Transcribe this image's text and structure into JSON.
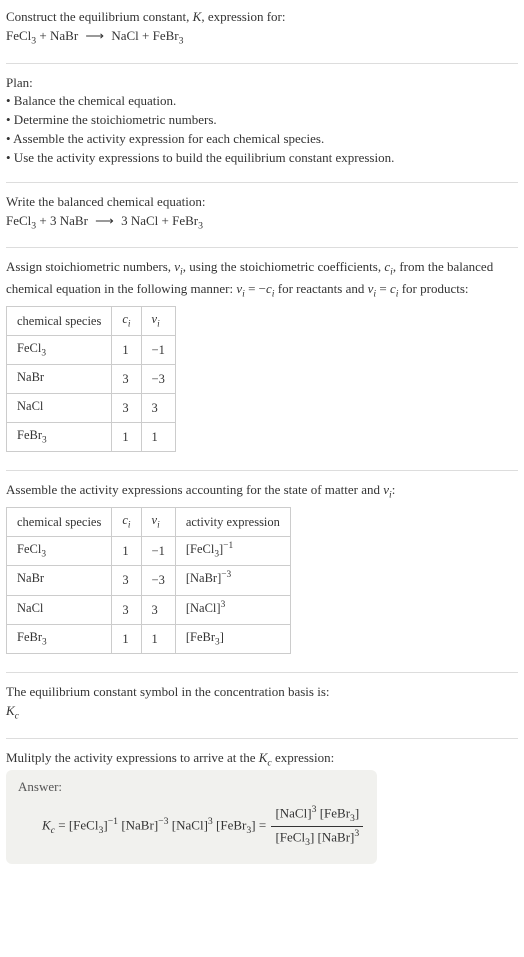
{
  "intro": {
    "line1_a": "Construct the equilibrium constant, ",
    "line1_k": "K",
    "line1_b": ", expression for:",
    "eq_lhs_a": "FeCl",
    "eq_lhs_b": " + NaBr",
    "eq_arrow": "⟶",
    "eq_rhs_a": "NaCl + FeBr"
  },
  "plan": {
    "heading": "Plan:",
    "b1": "• Balance the chemical equation.",
    "b2": "• Determine the stoichiometric numbers.",
    "b3": "• Assemble the activity expression for each chemical species.",
    "b4": "• Use the activity expressions to build the equilibrium constant expression."
  },
  "balanced": {
    "heading": "Write the balanced chemical equation:",
    "lhs_a": "FeCl",
    "lhs_b": " + 3 NaBr",
    "arrow": "⟶",
    "rhs_a": "3 NaCl + FeBr"
  },
  "assign": {
    "text_a": "Assign stoichiometric numbers, ",
    "nu": "ν",
    "sub_i": "i",
    "text_b": ", using the stoichiometric coefficients, ",
    "c": "c",
    "text_c": ", from the balanced chemical equation in the following manner: ",
    "rel1_a": "ν",
    "rel1_b": " = −",
    "rel1_c": "c",
    "text_d": " for reactants and ",
    "rel2_a": "ν",
    "rel2_b": " = ",
    "rel2_c": "c",
    "text_e": " for products:"
  },
  "table1": {
    "h1": "chemical species",
    "h2": "c",
    "h3": "ν",
    "hsub": "i",
    "rows": [
      {
        "s": "FeCl",
        "sub": "3",
        "c": "1",
        "v": "−1"
      },
      {
        "s": "NaBr",
        "sub": "",
        "c": "3",
        "v": "−3"
      },
      {
        "s": "NaCl",
        "sub": "",
        "c": "3",
        "v": "3"
      },
      {
        "s": "FeBr",
        "sub": "3",
        "c": "1",
        "v": "1"
      }
    ]
  },
  "assemble": {
    "text_a": "Assemble the activity expressions accounting for the state of matter and ",
    "nu": "ν",
    "sub_i": "i",
    "text_b": ":"
  },
  "table2": {
    "h1": "chemical species",
    "h2": "c",
    "h3": "ν",
    "h4": "activity expression",
    "hsub": "i",
    "rows": [
      {
        "s": "FeCl",
        "sub": "3",
        "c": "1",
        "v": "−1",
        "act_base": "[FeCl",
        "act_sub": "3",
        "act_close": "]",
        "act_exp": "−1"
      },
      {
        "s": "NaBr",
        "sub": "",
        "c": "3",
        "v": "−3",
        "act_base": "[NaBr",
        "act_sub": "",
        "act_close": "]",
        "act_exp": "−3"
      },
      {
        "s": "NaCl",
        "sub": "",
        "c": "3",
        "v": "3",
        "act_base": "[NaCl",
        "act_sub": "",
        "act_close": "]",
        "act_exp": "3"
      },
      {
        "s": "FeBr",
        "sub": "3",
        "c": "1",
        "v": "1",
        "act_base": "[FeBr",
        "act_sub": "3",
        "act_close": "]",
        "act_exp": ""
      }
    ]
  },
  "symbol": {
    "line": "The equilibrium constant symbol in the concentration basis is:",
    "k": "K",
    "ksub": "c"
  },
  "mult": {
    "text_a": "Mulitply the activity expressions to arrive at the ",
    "k": "K",
    "ksub": "c",
    "text_b": " expression:"
  },
  "answer": {
    "label": "Answer:",
    "lhs_k": "K",
    "lhs_ksub": "c",
    "eq": " = ",
    "t1": "[FeCl",
    "t1sub": "3",
    "t1c": "]",
    "t1e": "−1",
    "t2": "[NaBr",
    "t2c": "]",
    "t2e": "−3",
    "t3": "[NaCl",
    "t3c": "]",
    "t3e": "3",
    "t4": "[FeBr",
    "t4sub": "3",
    "t4c": "]",
    "eq2": " = ",
    "num_a": "[NaCl",
    "num_ac": "]",
    "num_ae": "3",
    "num_b": "[FeBr",
    "num_bsub": "3",
    "num_bc": "]",
    "den_a": "[FeCl",
    "den_asub": "3",
    "den_ac": "]",
    "den_b": "[NaBr",
    "den_bc": "]",
    "den_be": "3"
  }
}
